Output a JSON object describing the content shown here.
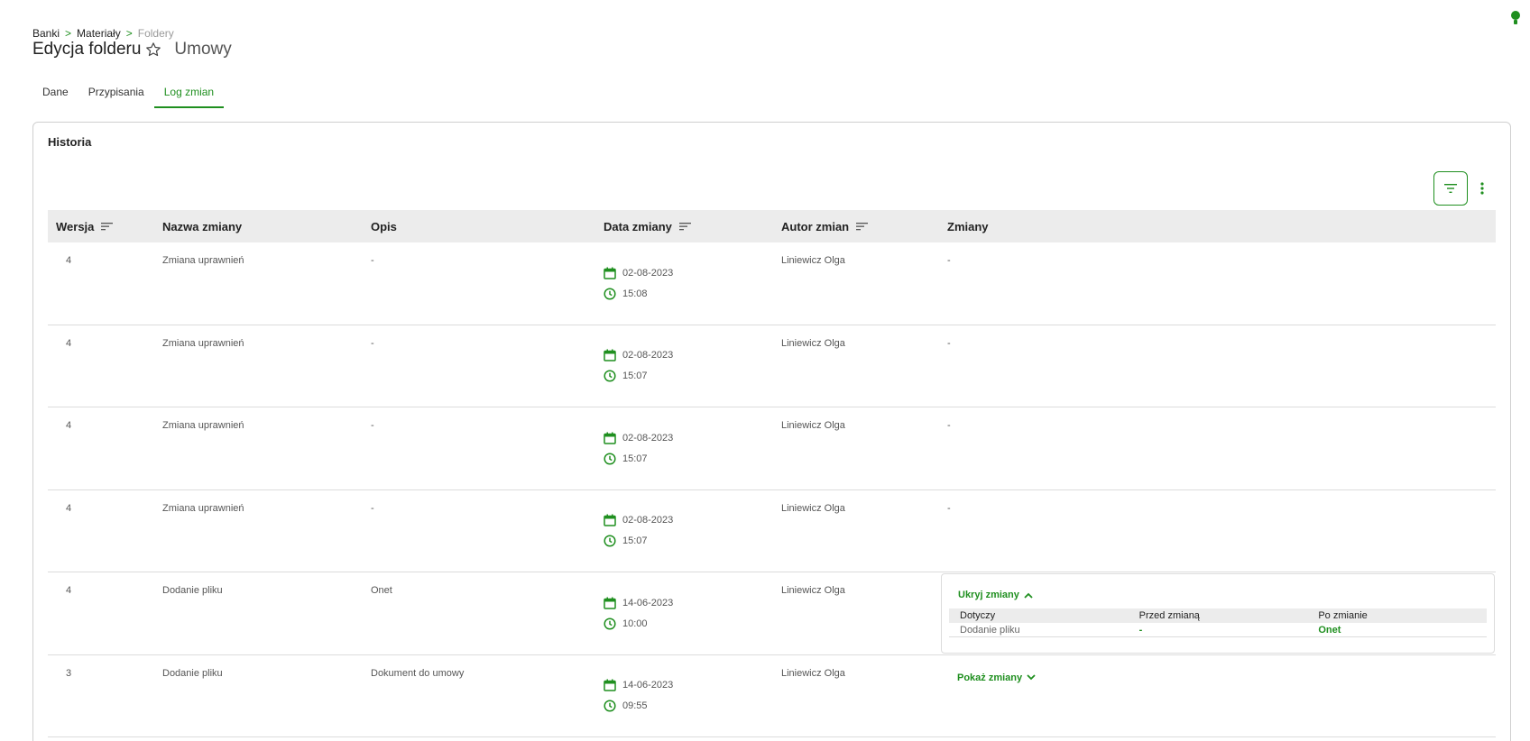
{
  "breadcrumb": {
    "items": [
      "Banki",
      "Materiały"
    ],
    "current": "Foldery",
    "separator": ">"
  },
  "header": {
    "title": "Edycja folderu",
    "subtitle": "Umowy"
  },
  "tabs": [
    {
      "label": "Dane",
      "active": false
    },
    {
      "label": "Przypisania",
      "active": false
    },
    {
      "label": "Log zmian",
      "active": true
    }
  ],
  "card": {
    "title": "Historia"
  },
  "table": {
    "columns": {
      "version": "Wersja",
      "name": "Nazwa zmiany",
      "description": "Opis",
      "date": "Data zmiany",
      "author": "Autor zmian",
      "changes": "Zmiany"
    },
    "rows": [
      {
        "version": "4",
        "name": "Zmiana uprawnień",
        "description": "-",
        "date": "02-08-2023",
        "time": "15:08",
        "author": "Liniewicz Olga",
        "changes": "-"
      },
      {
        "version": "4",
        "name": "Zmiana uprawnień",
        "description": "-",
        "date": "02-08-2023",
        "time": "15:07",
        "author": "Liniewicz Olga",
        "changes": "-"
      },
      {
        "version": "4",
        "name": "Zmiana uprawnień",
        "description": "-",
        "date": "02-08-2023",
        "time": "15:07",
        "author": "Liniewicz Olga",
        "changes": "-"
      },
      {
        "version": "4",
        "name": "Zmiana uprawnień",
        "description": "-",
        "date": "02-08-2023",
        "time": "15:07",
        "author": "Liniewicz Olga",
        "changes": "-"
      },
      {
        "version": "4",
        "name": "Dodanie pliku",
        "description": "Onet",
        "date": "14-06-2023",
        "time": "10:00",
        "author": "Liniewicz Olga",
        "changes_toggle": "Ukryj zmiany",
        "changes_table": {
          "headers": [
            "Dotyczy",
            "Przed zmianą",
            "Po zmianie"
          ],
          "row": [
            "Dodanie pliku",
            "-",
            "Onet"
          ]
        }
      },
      {
        "version": "3",
        "name": "Dodanie pliku",
        "description": "Dokument do umowy",
        "date": "14-06-2023",
        "time": "09:55",
        "author": "Liniewicz Olga",
        "changes_toggle": "Pokaż zmiany"
      }
    ]
  },
  "colors": {
    "accent": "#1f8f1f",
    "header_bg": "#ececec",
    "status_dot": "#1f8f1f"
  },
  "icons": {
    "status": "lightbulb-icon",
    "favorite": "star-outline-icon",
    "filter": "filter-icon",
    "more": "more-vertical-icon",
    "sort": "sort-icon",
    "date": "calendar-icon",
    "time": "clock-icon"
  }
}
